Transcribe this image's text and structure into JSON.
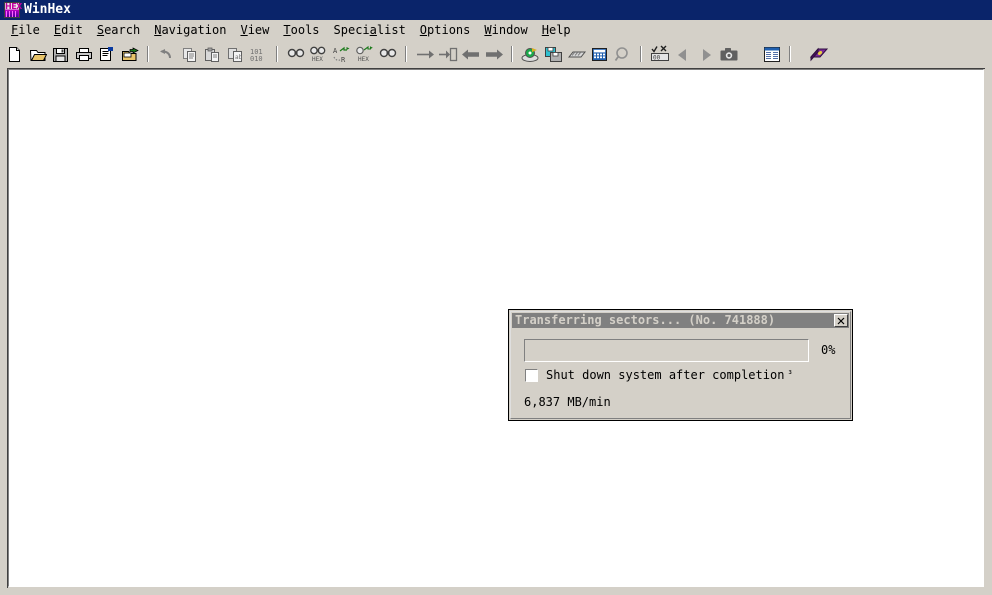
{
  "window": {
    "title": "WinHex",
    "icon": "winhex-app-icon",
    "icon_text": "HEX",
    "titlebar_color": "#0a246a",
    "face_color": "#d4d0c8"
  },
  "menubar": {
    "items": [
      {
        "label": "File",
        "accel": "F"
      },
      {
        "label": "Edit",
        "accel": "E"
      },
      {
        "label": "Search",
        "accel": "S"
      },
      {
        "label": "Navigation",
        "accel": "N"
      },
      {
        "label": "View",
        "accel": "V"
      },
      {
        "label": "Tools",
        "accel": "T"
      },
      {
        "label": "Specialist",
        "accel": "a"
      },
      {
        "label": "Options",
        "accel": "O"
      },
      {
        "label": "Window",
        "accel": "W"
      },
      {
        "label": "Help",
        "accel": "H"
      }
    ]
  },
  "toolbar": {
    "groups": [
      {
        "buttons": [
          {
            "icon": "new-file-icon",
            "label": "New"
          },
          {
            "icon": "open-folder-icon",
            "label": "Open"
          },
          {
            "icon": "save-disk-icon",
            "label": "Save"
          },
          {
            "icon": "print-icon",
            "label": "Print"
          },
          {
            "icon": "properties-icon",
            "label": "Properties"
          },
          {
            "icon": "open-folder-arrow-icon",
            "label": "Open Folder"
          }
        ]
      },
      {
        "buttons": [
          {
            "icon": "undo-icon",
            "label": "Undo"
          },
          {
            "icon": "copy-icon",
            "label": "Copy"
          },
          {
            "icon": "paste-icon",
            "label": "Paste"
          },
          {
            "icon": "paste-special-icon",
            "label": "Paste Special"
          },
          {
            "icon": "binary-101-icon",
            "label": "Binary Data"
          }
        ]
      },
      {
        "buttons": [
          {
            "icon": "find-text-icon",
            "label": "Find Text"
          },
          {
            "icon": "find-hex-icon",
            "label": "Find Hex Values"
          },
          {
            "icon": "replace-text-icon",
            "label": "Replace Text"
          },
          {
            "icon": "replace-hex-icon",
            "label": "Replace Hex Values"
          },
          {
            "icon": "find-again-icon",
            "label": "Continue Search"
          }
        ]
      },
      {
        "buttons": [
          {
            "icon": "goto-offset-icon",
            "label": "Go To Offset"
          },
          {
            "icon": "goto-page-icon",
            "label": "Go To Page"
          },
          {
            "icon": "navigate-back-icon",
            "label": "Back"
          },
          {
            "icon": "navigate-forward-icon",
            "label": "Forward"
          }
        ]
      },
      {
        "buttons": [
          {
            "icon": "open-disk-icon",
            "label": "Open Disk"
          },
          {
            "icon": "backup-disk-icon",
            "label": "Create Disk Image"
          },
          {
            "icon": "ram-chip-icon",
            "label": "Open RAM"
          },
          {
            "icon": "calculator-icon",
            "label": "Calculator"
          },
          {
            "icon": "magnifier-icon",
            "label": "Analyze"
          }
        ]
      },
      {
        "buttons": [
          {
            "icon": "checksum-icon",
            "label": "Compare"
          },
          {
            "icon": "prev-triangle-icon",
            "label": "Previous"
          },
          {
            "icon": "next-triangle-icon",
            "label": "Next"
          },
          {
            "icon": "camera-snapshot-icon",
            "label": "Snapshot"
          }
        ]
      },
      {
        "buttons": [
          {
            "icon": "data-table-icon",
            "label": "Data Interpreter"
          }
        ]
      },
      {
        "buttons": [
          {
            "icon": "manual-book-icon",
            "label": "Help Manual"
          }
        ]
      }
    ]
  },
  "dialog": {
    "title": "Transferring sectors... (No. 741888)",
    "close_label": "×",
    "progress": {
      "percent_label": "0%",
      "percent_value": 0
    },
    "shutdown_checkbox": {
      "label": "Shut down system after completion",
      "superscript": "³",
      "checked": false
    },
    "speed": "6,837 MB/min"
  }
}
